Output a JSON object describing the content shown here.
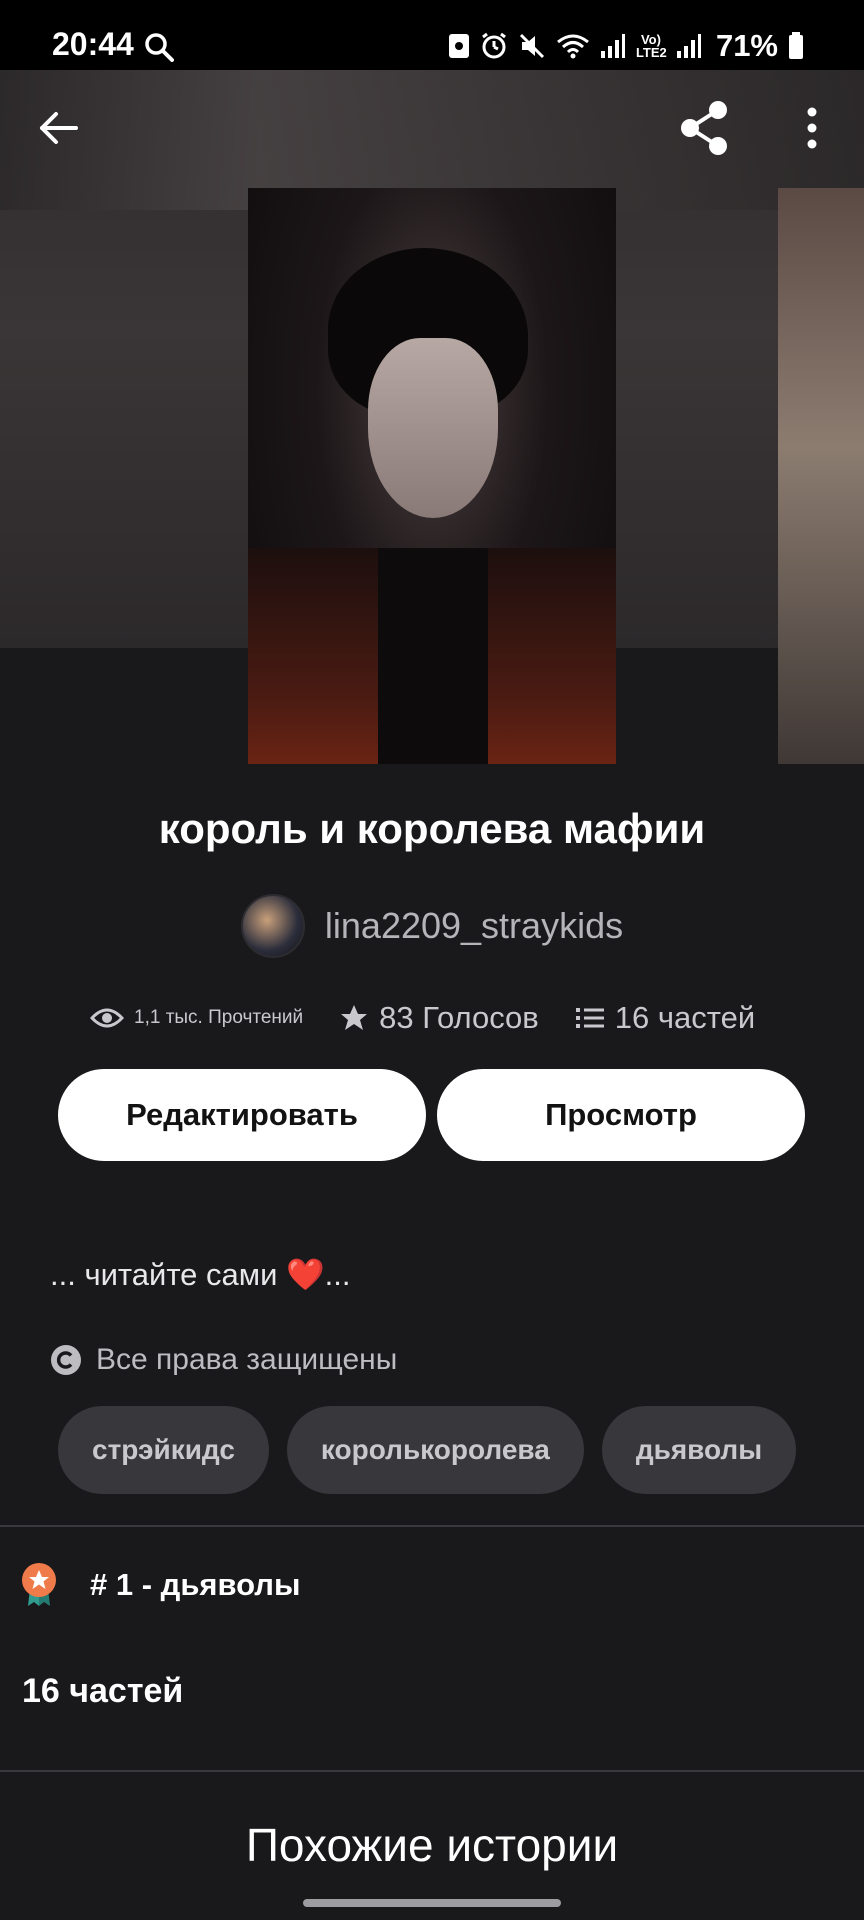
{
  "status_bar": {
    "time": "20:44",
    "battery": "71%",
    "network_label": "Vo) LTE2",
    "icons": [
      "search-icon",
      "lock-icon",
      "alarm-icon",
      "mute-icon",
      "wifi-icon",
      "signal-icon",
      "battery-icon"
    ]
  },
  "header": {
    "back_icon": "arrow-left-icon",
    "share_icon": "share-icon",
    "more_icon": "more-vertical-icon"
  },
  "story": {
    "title": "король и королева мафии",
    "author": "lina2209_straykids",
    "stats": {
      "reads": "1,1 тыс. Прочтений",
      "votes": "83 Голосов",
      "parts": "16 частей"
    },
    "buttons": {
      "edit": "Редактировать",
      "view": "Просмотр"
    },
    "description": "... читайте сами ❤️...",
    "copyright": "Все права защищены",
    "tags": [
      "стрэйкидс",
      "королькоролева",
      "дьяволы"
    ],
    "ranking": "# 1 - дьяволы",
    "parts_count": "16 частей"
  },
  "similar": {
    "title": "Похожие истории"
  },
  "colors": {
    "background": "#19181b",
    "button_bg": "#ffffff",
    "tag_bg": "#38373b",
    "rank_badge": "#f07b4a"
  }
}
